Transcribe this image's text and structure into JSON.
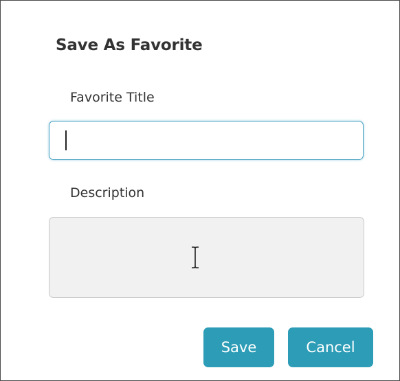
{
  "dialog": {
    "title": "Save As Favorite",
    "favorite_title": {
      "label": "Favorite Title",
      "value": ""
    },
    "description": {
      "label": "Description",
      "value": ""
    },
    "buttons": {
      "save_label": "Save",
      "cancel_label": "Cancel"
    }
  },
  "colors": {
    "accent": "#2d9db7",
    "focus_border": "#4aa3c2",
    "text": "#333333"
  },
  "icons": {
    "text_cursor": "text-caret",
    "mouse_pointer": "ibeam-icon"
  }
}
